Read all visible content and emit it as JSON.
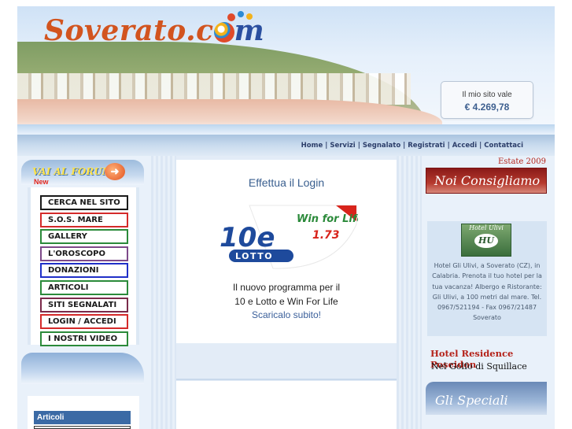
{
  "header": {
    "logo_main": "Soverato.c",
    "logo_tail": "m",
    "site_value_label": "Il mio sito vale",
    "site_value": "€ 4.269,78"
  },
  "nav": {
    "links": [
      "Home",
      "Servizi",
      "Segnalato",
      "Registrati",
      "Accedi",
      "Contattaci"
    ]
  },
  "left": {
    "forum_label": "VAI AL FORUM",
    "new_label": "New",
    "menu": [
      {
        "label": "CERCA NEL SITO",
        "color": "#1a1a1a"
      },
      {
        "label": "S.O.S. MARE",
        "color": "#d42a2a"
      },
      {
        "label": "GALLERY",
        "color": "#2b8a3a"
      },
      {
        "label": "L'OROSCOPO",
        "color": "#7d4a8a"
      },
      {
        "label": "DONAZIONI",
        "color": "#2030c8"
      },
      {
        "label": "ARTICOLI",
        "color": "#2b8a3a"
      },
      {
        "label": "SITI SEGNALATI",
        "color": "#7a2a4a"
      },
      {
        "label": "LOGIN / ACCEDI",
        "color": "#d42a2a"
      },
      {
        "label": "I NOSTRI VIDEO",
        "color": "#2b8a3a"
      }
    ],
    "articoli_label": "Articoli"
  },
  "center": {
    "login_title": "Effettua il Login",
    "lotto_logo_big": "10e",
    "lotto_logo_word": "LOTTO",
    "lotto_logo_win": "Win for Life!",
    "lotto_logo_ver": "1.73",
    "promo_line1": "Il nuovo programma per il",
    "promo_line2": "10 e Lotto e Win For Life",
    "promo_link": "Scaricalo subito!"
  },
  "right": {
    "estate_label": "Estate 2009",
    "consigliamo_label": "Noi Consigliamo",
    "hotel_logo_text": "Hotel Ulivi",
    "hotel_logo_mark": "HU",
    "hotel_desc": "Hotel Gli Ulivi, a Soverato (CZ), in Calabria. Prenota il tuo hotel per la tua vacanza! Albergo e Ristorante: Gli Ulivi, a 100 metri dal mare. Tel. 0967/521194 - Fax 0967/21487 Soverato",
    "poseidon_title": "Hotel Residence Poseidon",
    "poseidon_sub": "Nel Golfo di Squillace",
    "speciali_label": "Gli Speciali"
  },
  "colors": {
    "logo_orange": "#d2541f",
    "logo_blue": "#2a4fa0",
    "nav_text": "#2c3e6a",
    "hotel_red": "#b5241b"
  }
}
